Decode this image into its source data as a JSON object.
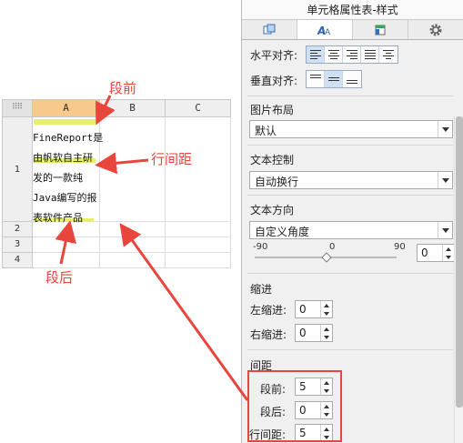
{
  "sheet": {
    "columns": [
      "A",
      "B",
      "C"
    ],
    "rows": [
      "1",
      "2",
      "3",
      "4"
    ],
    "cell_a1_lines": [
      "FineReport是",
      "由帆软自主研",
      "发的一款纯",
      "Java编写的报",
      "表软件产品"
    ]
  },
  "annotations": {
    "before": "段前",
    "line_spacing": "行间距",
    "after": "段后"
  },
  "panel": {
    "title": "单元格属性表-样式",
    "tabs": [
      {
        "icon": "cell-style-icon"
      },
      {
        "icon": "font-style-icon"
      },
      {
        "icon": "condition-icon"
      },
      {
        "icon": "gear-icon"
      }
    ],
    "h_align_label": "水平对齐:",
    "v_align_label": "垂直对齐:",
    "image_layout": {
      "label": "图片布局",
      "value": "默认"
    },
    "text_control": {
      "label": "文本控制",
      "value": "自动换行"
    },
    "text_direction": {
      "label": "文本方向",
      "value": "自定义角度",
      "min": "-90",
      "mid": "0",
      "max": "90",
      "angle": "0"
    },
    "indent": {
      "label": "缩进",
      "left_label": "左缩进:",
      "left_value": "0",
      "right_label": "右缩进:",
      "right_value": "0"
    },
    "spacing": {
      "label": "间距",
      "before_label": "段前:",
      "before_value": "5",
      "after_label": "段后:",
      "after_value": "0",
      "line_label": "行间距:",
      "line_value": "5"
    }
  },
  "colors": {
    "annotation": "#e8453c",
    "highlight": "#e8f069",
    "selected_col": "#f7c98c"
  }
}
